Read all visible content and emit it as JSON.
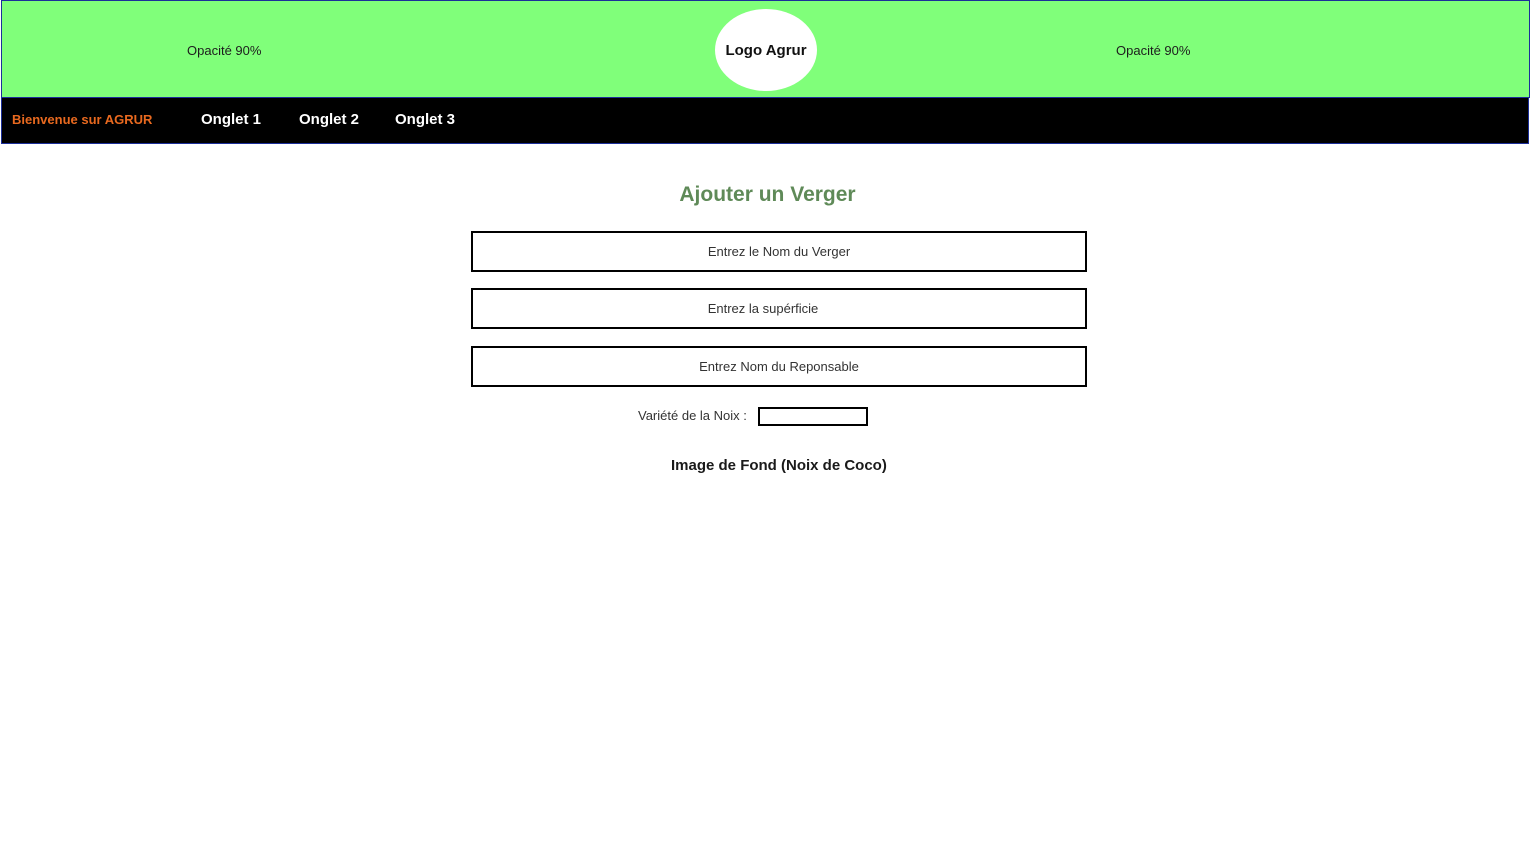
{
  "header": {
    "opacity_left": "Opacité 90%",
    "logo_text": "Logo Agrur",
    "opacity_right": "Opacité 90%",
    "background_color": "#80ff7a"
  },
  "navbar": {
    "welcome": "Bienvenue sur AGRUR",
    "tabs": [
      {
        "label": "Onglet 1"
      },
      {
        "label": "Onglet 2"
      },
      {
        "label": "Onglet 3"
      }
    ],
    "welcome_color": "#e8691f",
    "background_color": "#000000"
  },
  "form": {
    "title": "Ajouter un Verger",
    "title_color": "#5f8a58",
    "name_placeholder": "Entrez le Nom du Verger",
    "area_placeholder": "Entrez la supérficie",
    "manager_placeholder": "Entrez Nom du Reponsable",
    "variety_label": "Variété de la Noix :",
    "variety_value": "",
    "background_image_label": "Image de Fond (Noix de Coco)"
  }
}
